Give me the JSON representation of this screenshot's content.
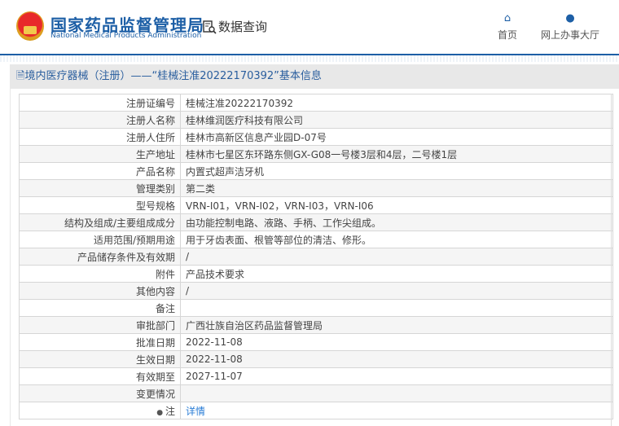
{
  "header": {
    "logo_cn": "国家药品监督管理局",
    "logo_en": "National Medical Products Administration",
    "query_label": "数据查询",
    "nav": [
      {
        "label": "首页",
        "icon": "home-icon"
      },
      {
        "label": "网上办事大厅",
        "icon": "user-icon"
      }
    ]
  },
  "title": "境内医疗器械（注册）——“桂械注准20222170392”基本信息",
  "rows": [
    {
      "k": "注册证编号",
      "v": "桂械注准20222170392"
    },
    {
      "k": "注册人名称",
      "v": "桂林维润医疗科技有限公司"
    },
    {
      "k": "注册人住所",
      "v": "桂林市高新区信息产业园D-07号"
    },
    {
      "k": "生产地址",
      "v": "桂林市七星区东环路东侧GX-G08一号楼3层和4层，二号楼1层"
    },
    {
      "k": "产品名称",
      "v": "内置式超声洁牙机"
    },
    {
      "k": "管理类别",
      "v": "第二类"
    },
    {
      "k": "型号规格",
      "v": "VRN-I01，VRN-I02，VRN-I03，VRN-I06"
    },
    {
      "k": "结构及组成/主要组成成分",
      "v": "由功能控制电路、液路、手柄、工作尖组成。"
    },
    {
      "k": "适用范围/预期用途",
      "v": "用于牙齿表面、根管等部位的清洁、修形。"
    },
    {
      "k": "产品储存条件及有效期",
      "v": "/"
    },
    {
      "k": "附件",
      "v": "产品技术要求"
    },
    {
      "k": "其他内容",
      "v": "/"
    },
    {
      "k": "备注",
      "v": ""
    },
    {
      "k": "审批部门",
      "v": "广西壮族自治区药品监督管理局"
    },
    {
      "k": "批准日期",
      "v": "2022-11-08"
    },
    {
      "k": "生效日期",
      "v": "2022-11-08"
    },
    {
      "k": "有效期至",
      "v": "2027-11-07"
    },
    {
      "k": "变更情况",
      "v": ""
    },
    {
      "k": "注",
      "v": "详情"
    }
  ]
}
